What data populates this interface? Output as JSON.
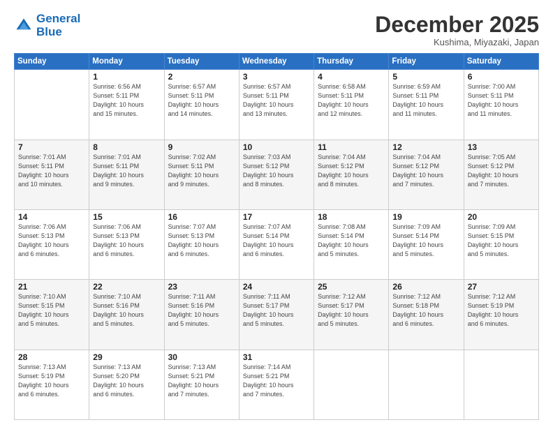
{
  "logo": {
    "line1": "General",
    "line2": "Blue"
  },
  "title": "December 2025",
  "subtitle": "Kushima, Miyazaki, Japan",
  "days_of_week": [
    "Sunday",
    "Monday",
    "Tuesday",
    "Wednesday",
    "Thursday",
    "Friday",
    "Saturday"
  ],
  "weeks": [
    [
      {
        "day": "",
        "info": ""
      },
      {
        "day": "1",
        "info": "Sunrise: 6:56 AM\nSunset: 5:11 PM\nDaylight: 10 hours\nand 15 minutes."
      },
      {
        "day": "2",
        "info": "Sunrise: 6:57 AM\nSunset: 5:11 PM\nDaylight: 10 hours\nand 14 minutes."
      },
      {
        "day": "3",
        "info": "Sunrise: 6:57 AM\nSunset: 5:11 PM\nDaylight: 10 hours\nand 13 minutes."
      },
      {
        "day": "4",
        "info": "Sunrise: 6:58 AM\nSunset: 5:11 PM\nDaylight: 10 hours\nand 12 minutes."
      },
      {
        "day": "5",
        "info": "Sunrise: 6:59 AM\nSunset: 5:11 PM\nDaylight: 10 hours\nand 11 minutes."
      },
      {
        "day": "6",
        "info": "Sunrise: 7:00 AM\nSunset: 5:11 PM\nDaylight: 10 hours\nand 11 minutes."
      }
    ],
    [
      {
        "day": "7",
        "info": "Sunrise: 7:01 AM\nSunset: 5:11 PM\nDaylight: 10 hours\nand 10 minutes."
      },
      {
        "day": "8",
        "info": "Sunrise: 7:01 AM\nSunset: 5:11 PM\nDaylight: 10 hours\nand 9 minutes."
      },
      {
        "day": "9",
        "info": "Sunrise: 7:02 AM\nSunset: 5:11 PM\nDaylight: 10 hours\nand 9 minutes."
      },
      {
        "day": "10",
        "info": "Sunrise: 7:03 AM\nSunset: 5:12 PM\nDaylight: 10 hours\nand 8 minutes."
      },
      {
        "day": "11",
        "info": "Sunrise: 7:04 AM\nSunset: 5:12 PM\nDaylight: 10 hours\nand 8 minutes."
      },
      {
        "day": "12",
        "info": "Sunrise: 7:04 AM\nSunset: 5:12 PM\nDaylight: 10 hours\nand 7 minutes."
      },
      {
        "day": "13",
        "info": "Sunrise: 7:05 AM\nSunset: 5:12 PM\nDaylight: 10 hours\nand 7 minutes."
      }
    ],
    [
      {
        "day": "14",
        "info": "Sunrise: 7:06 AM\nSunset: 5:13 PM\nDaylight: 10 hours\nand 6 minutes."
      },
      {
        "day": "15",
        "info": "Sunrise: 7:06 AM\nSunset: 5:13 PM\nDaylight: 10 hours\nand 6 minutes."
      },
      {
        "day": "16",
        "info": "Sunrise: 7:07 AM\nSunset: 5:13 PM\nDaylight: 10 hours\nand 6 minutes."
      },
      {
        "day": "17",
        "info": "Sunrise: 7:07 AM\nSunset: 5:14 PM\nDaylight: 10 hours\nand 6 minutes."
      },
      {
        "day": "18",
        "info": "Sunrise: 7:08 AM\nSunset: 5:14 PM\nDaylight: 10 hours\nand 5 minutes."
      },
      {
        "day": "19",
        "info": "Sunrise: 7:09 AM\nSunset: 5:14 PM\nDaylight: 10 hours\nand 5 minutes."
      },
      {
        "day": "20",
        "info": "Sunrise: 7:09 AM\nSunset: 5:15 PM\nDaylight: 10 hours\nand 5 minutes."
      }
    ],
    [
      {
        "day": "21",
        "info": "Sunrise: 7:10 AM\nSunset: 5:15 PM\nDaylight: 10 hours\nand 5 minutes."
      },
      {
        "day": "22",
        "info": "Sunrise: 7:10 AM\nSunset: 5:16 PM\nDaylight: 10 hours\nand 5 minutes."
      },
      {
        "day": "23",
        "info": "Sunrise: 7:11 AM\nSunset: 5:16 PM\nDaylight: 10 hours\nand 5 minutes."
      },
      {
        "day": "24",
        "info": "Sunrise: 7:11 AM\nSunset: 5:17 PM\nDaylight: 10 hours\nand 5 minutes."
      },
      {
        "day": "25",
        "info": "Sunrise: 7:12 AM\nSunset: 5:17 PM\nDaylight: 10 hours\nand 5 minutes."
      },
      {
        "day": "26",
        "info": "Sunrise: 7:12 AM\nSunset: 5:18 PM\nDaylight: 10 hours\nand 6 minutes."
      },
      {
        "day": "27",
        "info": "Sunrise: 7:12 AM\nSunset: 5:19 PM\nDaylight: 10 hours\nand 6 minutes."
      }
    ],
    [
      {
        "day": "28",
        "info": "Sunrise: 7:13 AM\nSunset: 5:19 PM\nDaylight: 10 hours\nand 6 minutes."
      },
      {
        "day": "29",
        "info": "Sunrise: 7:13 AM\nSunset: 5:20 PM\nDaylight: 10 hours\nand 6 minutes."
      },
      {
        "day": "30",
        "info": "Sunrise: 7:13 AM\nSunset: 5:21 PM\nDaylight: 10 hours\nand 7 minutes."
      },
      {
        "day": "31",
        "info": "Sunrise: 7:14 AM\nSunset: 5:21 PM\nDaylight: 10 hours\nand 7 minutes."
      },
      {
        "day": "",
        "info": ""
      },
      {
        "day": "",
        "info": ""
      },
      {
        "day": "",
        "info": ""
      }
    ]
  ]
}
